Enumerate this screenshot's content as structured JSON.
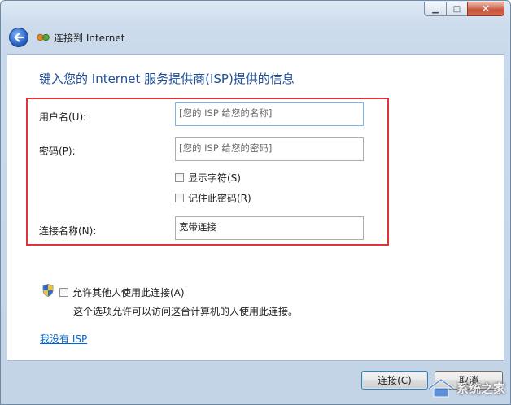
{
  "window": {
    "title": "连接到 Internet"
  },
  "heading": "键入您的 Internet 服务提供商(ISP)提供的信息",
  "form": {
    "username_label": "用户名(U):",
    "username_placeholder": "[您的 ISP 给您的名称]",
    "password_label": "密码(P):",
    "password_placeholder": "[您的 ISP 给您的密码]",
    "show_chars_label": "显示字符(S)",
    "remember_password_label": "记住此密码(R)",
    "connection_name_label": "连接名称(N):",
    "connection_name_value": "宽带连接"
  },
  "sharing": {
    "allow_label": "允许其他人使用此连接(A)",
    "description": "这个选项允许可以访问这台计算机的人使用此连接。"
  },
  "no_isp_link": "我没有 ISP",
  "buttons": {
    "connect": "连接(C)",
    "cancel": "取消"
  },
  "watermark": "系统之家",
  "colors": {
    "heading": "#1f4e99",
    "highlight_border": "#e0323a",
    "link": "#0066cc"
  }
}
